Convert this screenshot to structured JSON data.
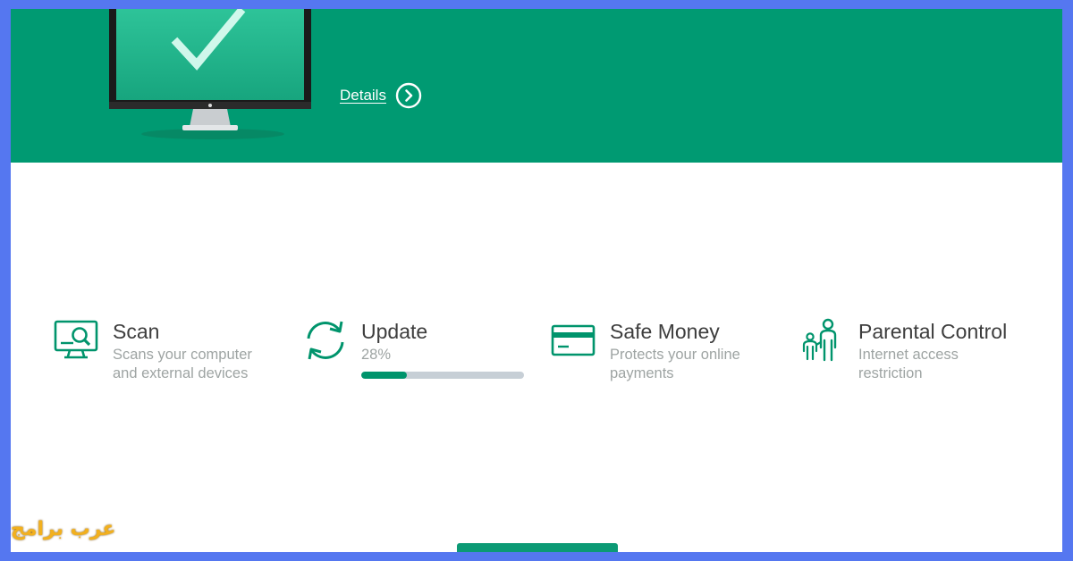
{
  "banner": {
    "details_label": "Details"
  },
  "tiles": [
    {
      "title": "Scan",
      "description": "Scans your computer and external devices",
      "icon": "scan-monitor-icon"
    },
    {
      "title": "Update",
      "progress_text": "28%",
      "progress": 0.28,
      "icon": "update-arrows-icon"
    },
    {
      "title": "Safe Money",
      "description": "Protects your online payments",
      "icon": "credit-card-icon"
    },
    {
      "title": "Parental Control",
      "description": "Internet access restriction",
      "icon": "parent-child-icon"
    }
  ],
  "watermark": "عرب برامج",
  "colors": {
    "brand_green": "#009a72",
    "icon_green": "#00946c",
    "page_border": "#5577f0",
    "title_text": "#3d3d3d",
    "desc_text": "#9ea4a3"
  }
}
